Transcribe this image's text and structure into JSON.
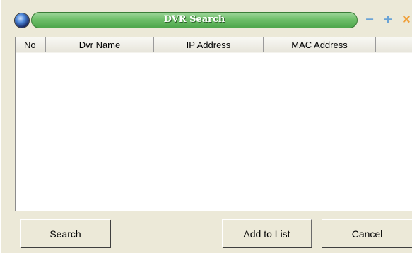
{
  "window": {
    "title": "DVR Search",
    "controls": {
      "minimize": "−",
      "maximize": "+",
      "close": "×"
    }
  },
  "table": {
    "columns": [
      "No",
      "Dvr Name",
      "IP Address",
      "MAC Address",
      ""
    ],
    "rows": []
  },
  "buttons": {
    "search": "Search",
    "add_to_list": "Add to List",
    "cancel": "Cancel"
  },
  "colors": {
    "title_bar": "#6fbf6a",
    "window_bg": "#ece9d8",
    "close": "#f0a03a",
    "min_max": "#6aa3d6"
  }
}
